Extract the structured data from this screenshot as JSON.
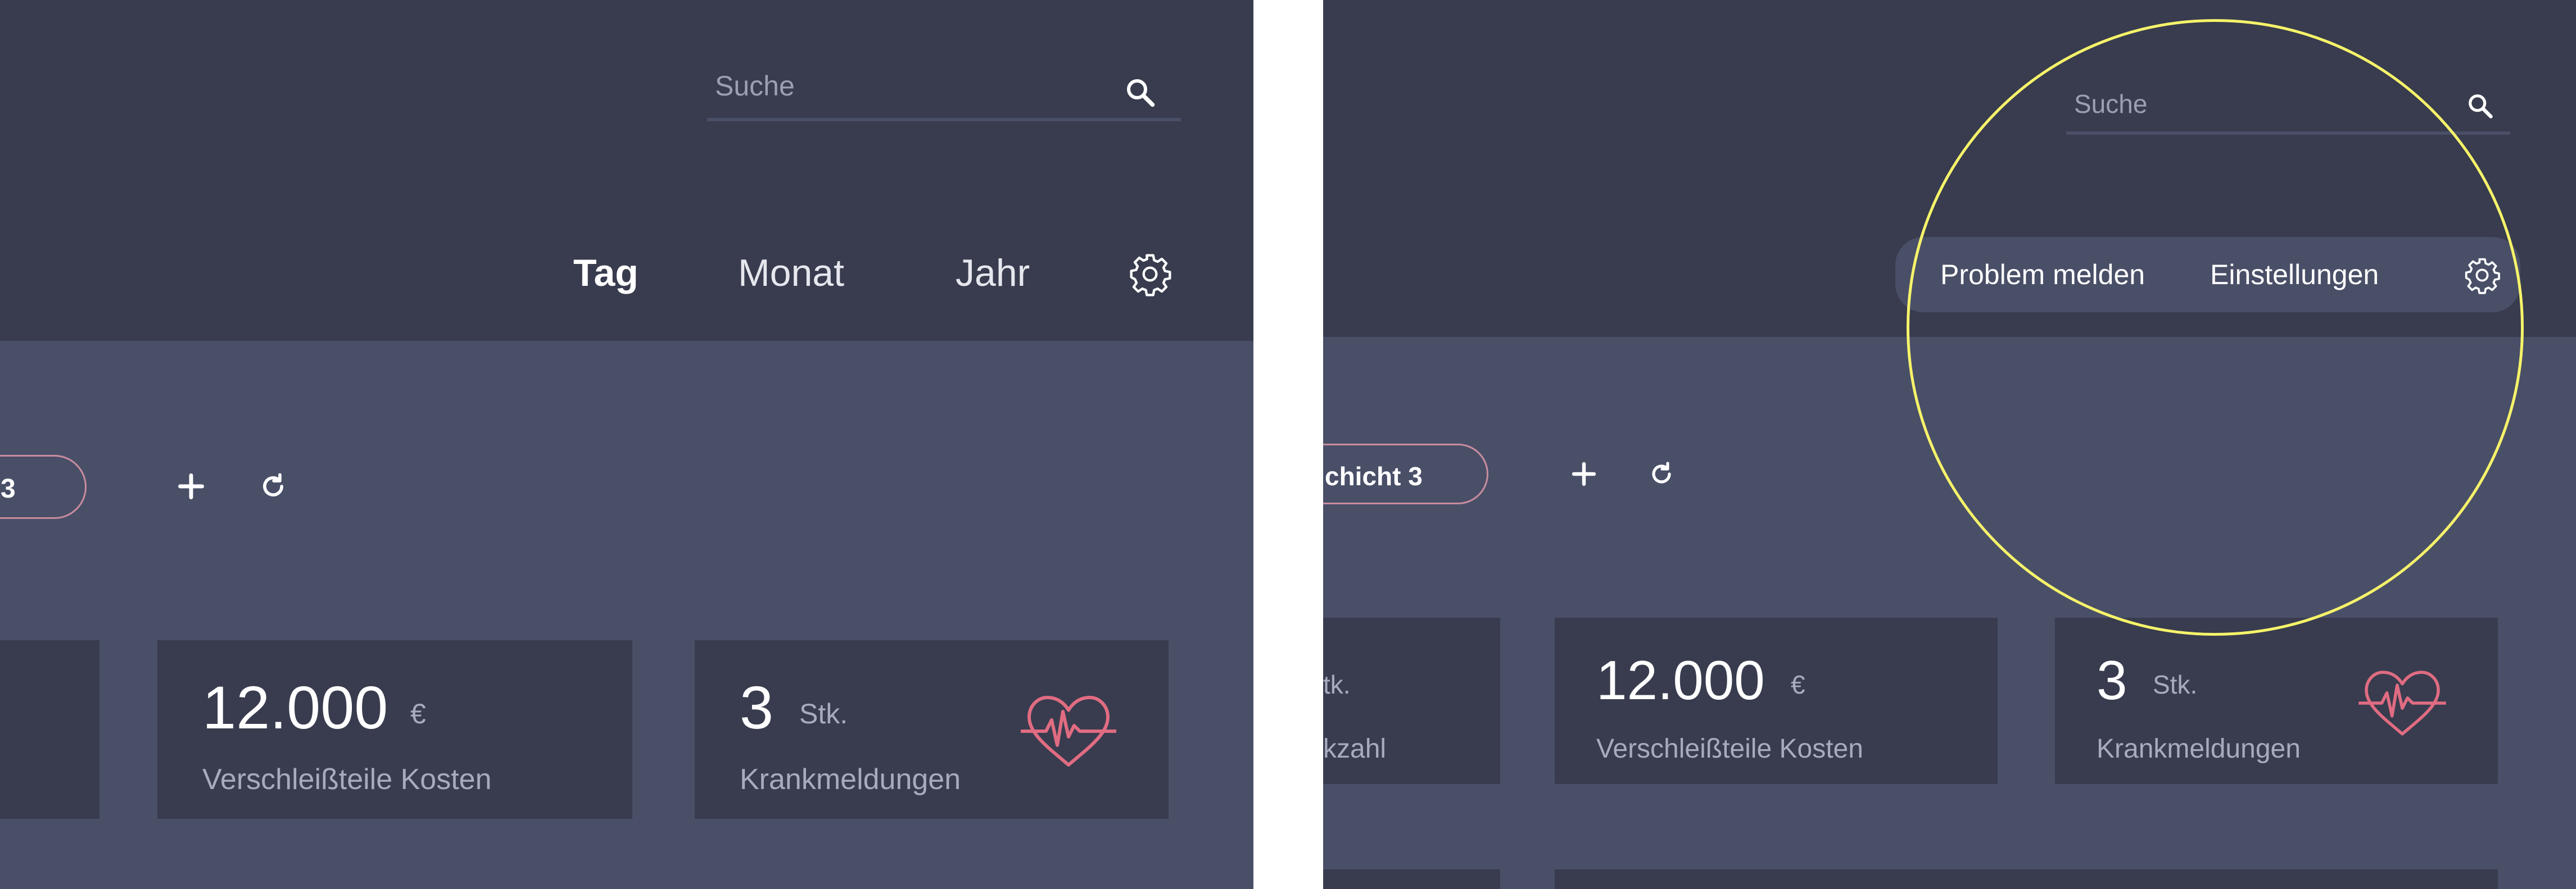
{
  "left_panel": {
    "search": {
      "placeholder": "Suche"
    },
    "tabs": [
      {
        "label": "Tag",
        "active": true
      },
      {
        "label": "Monat",
        "active": false
      },
      {
        "label": "Jahr",
        "active": false
      }
    ],
    "shift_chip": {
      "label": "3"
    },
    "cards": [
      {
        "value": "12.000",
        "unit": "€",
        "label": "Verschleißteile Kosten"
      },
      {
        "value": "3",
        "unit": "Stk.",
        "label": "Krankmeldungen",
        "icon": "heart-pulse-icon"
      }
    ]
  },
  "right_panel": {
    "search": {
      "placeholder": "Suche"
    },
    "settings_menu": {
      "items": [
        {
          "label": "Problem melden"
        },
        {
          "label": "Einstellungen"
        }
      ]
    },
    "shift_chip": {
      "label": "chicht 3"
    },
    "partial_card": {
      "unit": "tk.",
      "label": "kzahl"
    },
    "cards": [
      {
        "value": "12.000",
        "unit": "€",
        "label": "Verschleißteile Kosten"
      },
      {
        "value": "3",
        "unit": "Stk.",
        "label": "Krankmeldungen",
        "icon": "heart-pulse-icon"
      }
    ]
  },
  "colors": {
    "header_bg": "#383c4e",
    "body_bg": "#4a4f68",
    "card_bg": "#383c4e",
    "accent_pink": "#e06c82",
    "highlight_yellow": "#f6f36a"
  }
}
